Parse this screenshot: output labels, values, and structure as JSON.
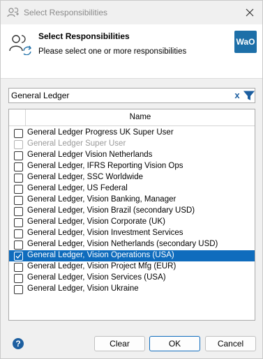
{
  "window": {
    "title": "Select Responsibilities",
    "close_icon": "close-icon"
  },
  "header": {
    "title": "Select Responsibilities",
    "subtitle": "Please select one or more responsibilities",
    "logo_text": "WaO",
    "logo_color": "#1d6fa8"
  },
  "search": {
    "value": "General Ledger",
    "clear_label": "x"
  },
  "list": {
    "column_name": "Name",
    "selection_color": "#0f6cbd",
    "items": [
      {
        "label": "General Ledger Progress UK Super User",
        "checked": false,
        "disabled": false,
        "selected": false
      },
      {
        "label": "General Ledger Super User",
        "checked": false,
        "disabled": true,
        "selected": false
      },
      {
        "label": "General Ledger Vision Netherlands",
        "checked": false,
        "disabled": false,
        "selected": false
      },
      {
        "label": "General Ledger, IFRS Reporting Vision Ops",
        "checked": false,
        "disabled": false,
        "selected": false
      },
      {
        "label": "General Ledger, SSC Worldwide",
        "checked": false,
        "disabled": false,
        "selected": false
      },
      {
        "label": "General Ledger, US Federal",
        "checked": false,
        "disabled": false,
        "selected": false
      },
      {
        "label": "General Ledger, Vision Banking, Manager",
        "checked": false,
        "disabled": false,
        "selected": false
      },
      {
        "label": "General Ledger, Vision Brazil (secondary USD)",
        "checked": false,
        "disabled": false,
        "selected": false
      },
      {
        "label": "General Ledger, Vision Corporate (UK)",
        "checked": false,
        "disabled": false,
        "selected": false
      },
      {
        "label": "General Ledger, Vision Investment Services",
        "checked": false,
        "disabled": false,
        "selected": false
      },
      {
        "label": "General Ledger, Vision Netherlands (secondary USD)",
        "checked": false,
        "disabled": false,
        "selected": false
      },
      {
        "label": "General Ledger, Vision Operations (USA)",
        "checked": true,
        "disabled": false,
        "selected": true
      },
      {
        "label": "General Ledger, Vision Project Mfg (EUR)",
        "checked": false,
        "disabled": false,
        "selected": false
      },
      {
        "label": "General Ledger, Vision Services (USA)",
        "checked": false,
        "disabled": false,
        "selected": false
      },
      {
        "label": "General Ledger, Vision Ukraine",
        "checked": false,
        "disabled": false,
        "selected": false
      }
    ]
  },
  "footer": {
    "help_label": "?",
    "clear_label": "Clear",
    "ok_label": "OK",
    "cancel_label": "Cancel"
  }
}
